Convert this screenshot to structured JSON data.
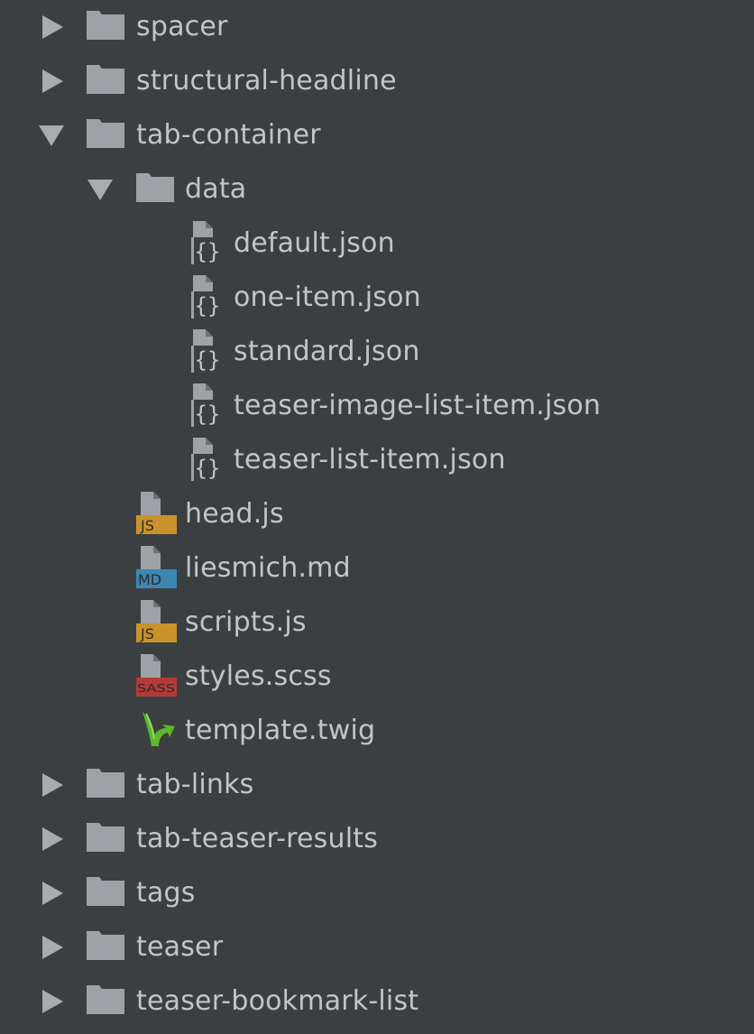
{
  "tree": {
    "items": [
      {
        "label": "spacer",
        "type": "folder",
        "state": "collapsed"
      },
      {
        "label": "structural-headline",
        "type": "folder",
        "state": "collapsed"
      },
      {
        "label": "tab-container",
        "type": "folder",
        "state": "expanded"
      },
      {
        "label": "data",
        "type": "folder",
        "state": "expanded"
      },
      {
        "label": "default.json",
        "type": "file",
        "icon": "json-file-icon"
      },
      {
        "label": "one-item.json",
        "type": "file",
        "icon": "json-file-icon"
      },
      {
        "label": "standard.json",
        "type": "file",
        "icon": "json-file-icon"
      },
      {
        "label": "teaser-image-list-item.json",
        "type": "file",
        "icon": "json-file-icon"
      },
      {
        "label": "teaser-list-item.json",
        "type": "file",
        "icon": "json-file-icon"
      },
      {
        "label": "head.js",
        "type": "file",
        "icon": "js-file-icon",
        "badge": "JS"
      },
      {
        "label": "liesmich.md",
        "type": "file",
        "icon": "md-file-icon",
        "badge": "MD"
      },
      {
        "label": "scripts.js",
        "type": "file",
        "icon": "js-file-icon",
        "badge": "JS"
      },
      {
        "label": "styles.scss",
        "type": "file",
        "icon": "sass-file-icon",
        "badge": "SASS"
      },
      {
        "label": "template.twig",
        "type": "file",
        "icon": "twig-file-icon"
      },
      {
        "label": "tab-links",
        "type": "folder",
        "state": "collapsed"
      },
      {
        "label": "tab-teaser-results",
        "type": "folder",
        "state": "collapsed"
      },
      {
        "label": "tags",
        "type": "folder",
        "state": "collapsed"
      },
      {
        "label": "teaser",
        "type": "folder",
        "state": "collapsed"
      },
      {
        "label": "teaser-bookmark-list",
        "type": "folder",
        "state": "collapsed"
      }
    ]
  },
  "colors": {
    "background": "#3c3f41",
    "text": "#c3c5c7",
    "folder": "#9ea2a6",
    "arrow": "#a8acaf",
    "js_badge": "#c9922b",
    "md_badge": "#3d87b4",
    "sass_badge": "#b43a3a",
    "twig": "#5cb82a"
  }
}
